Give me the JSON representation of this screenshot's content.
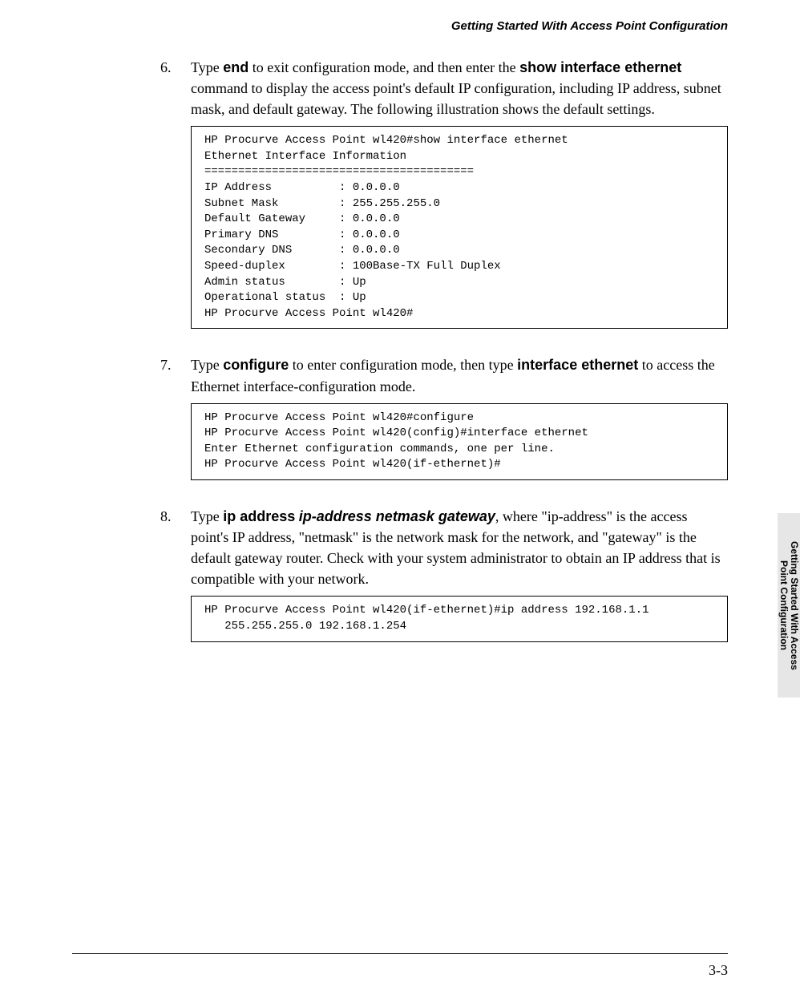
{
  "header": {
    "title": "Getting Started With Access Point Configuration"
  },
  "steps": [
    {
      "num": "6.",
      "pre1": "Type ",
      "bold1": "end",
      "mid1": " to exit configuration mode, and then enter the ",
      "bold2": "show interface ethernet",
      "post1": " command to display the access point's default IP configuration, including IP address, subnet mask, and default gateway. The following illustration shows the default settings.",
      "code": "HP Procurve Access Point wl420#show interface ethernet\nEthernet Interface Information\n========================================\nIP Address          : 0.0.0.0\nSubnet Mask         : 255.255.255.0\nDefault Gateway     : 0.0.0.0\nPrimary DNS         : 0.0.0.0\nSecondary DNS       : 0.0.0.0\nSpeed-duplex        : 100Base-TX Full Duplex\nAdmin status        : Up\nOperational status  : Up\nHP Procurve Access Point wl420#"
    },
    {
      "num": "7.",
      "pre1": "Type ",
      "bold1": "configure",
      "mid1": " to enter configuration mode, then type ",
      "bold2": "interface ethernet",
      "post1": " to access the Ethernet interface-configuration mode.",
      "code": "HP Procurve Access Point wl420#configure\nHP Procurve Access Point wl420(config)#interface ethernet\nEnter Ethernet configuration commands, one per line.\nHP Procurve Access Point wl420(if-ethernet)#"
    },
    {
      "num": "8.",
      "pre1": "Type ",
      "bold1": "ip address",
      "mid1": " ",
      "italic1": "ip-address netmask gateway",
      "post1": ", where \"ip-address\" is the access point's IP address, \"netmask\" is the network mask for the network, and \"gateway\" is the default gateway router. Check with your system administrator to obtain an IP address that is compatible with your network.",
      "code": "HP Procurve Access Point wl420(if-ethernet)#ip address 192.168.1.1\n   255.255.255.0 192.168.1.254"
    }
  ],
  "sidetab": {
    "line1": "Getting Started With Access",
    "line2": "Point Configuration"
  },
  "footer": {
    "page": "3-3"
  }
}
